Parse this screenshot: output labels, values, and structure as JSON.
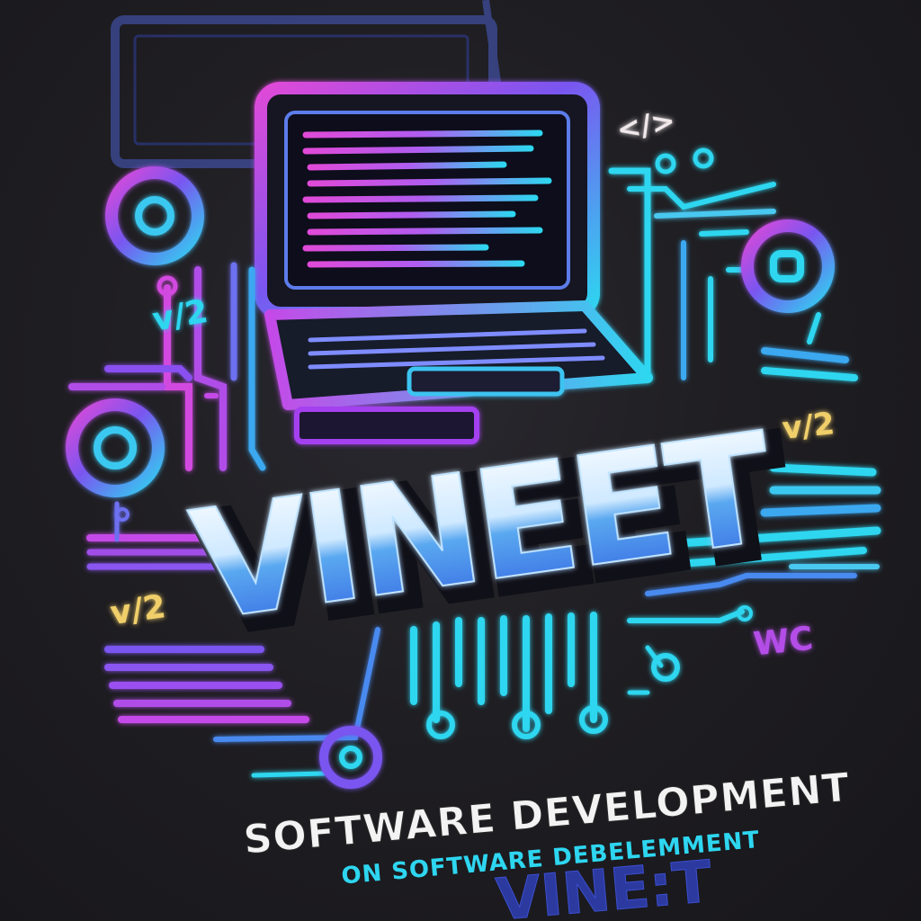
{
  "logo": {
    "brand_name": "VINEET",
    "tagline": "SOFTWARE DEVELOPMENT",
    "sub_tagline": "ON SOFTWARE DEBELEMMENT",
    "footer_brand": "VINE:T",
    "code_tags": [
      "v/2",
      "v/2",
      "v/2",
      "</>",
      "WC"
    ]
  },
  "colors": {
    "background": "#1f1e22",
    "cyan": "#2ed6f0",
    "blue": "#3b6fe8",
    "purple": "#a43ff0",
    "magenta": "#e04ad8"
  }
}
